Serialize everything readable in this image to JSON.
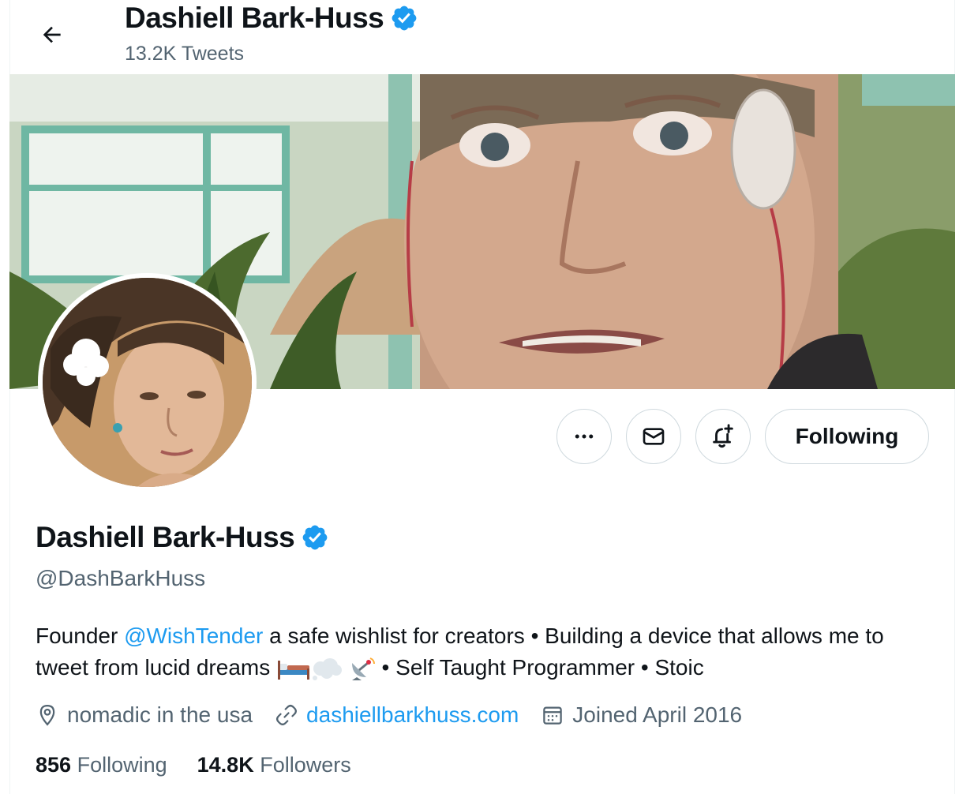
{
  "header": {
    "name": "Dashiell Bark-Huss",
    "tweets_count": "13.2K Tweets"
  },
  "actions": {
    "more_label": "•••",
    "following_label": "Following"
  },
  "profile": {
    "name": "Dashiell Bark-Huss",
    "handle": "@DashBarkHuss",
    "bio": {
      "part1": "Founder ",
      "mention": "@WishTender",
      "part2": " a safe wishlist for creators •  Building a device that allows me to tweet from lucid dreams ",
      "part3": " • Self Taught Programmer • Stoic"
    },
    "location": "nomadic in the usa",
    "website": "dashiellbarkhuss.com",
    "joined": "Joined April 2016"
  },
  "stats": {
    "following_count": "856",
    "following_label": "Following",
    "followers_count": "14.8K",
    "followers_label": "Followers"
  },
  "colors": {
    "accent": "#1d9bf0",
    "secondary_text": "#536471",
    "border": "#cfd9de"
  },
  "icons": [
    "back-arrow-icon",
    "verified-badge-icon",
    "more-icon",
    "mail-icon",
    "notification-bell-icon",
    "location-pin-icon",
    "link-icon",
    "calendar-icon",
    "bed-emoji",
    "thought-bubble-emoji",
    "satellite-antenna-emoji"
  ]
}
